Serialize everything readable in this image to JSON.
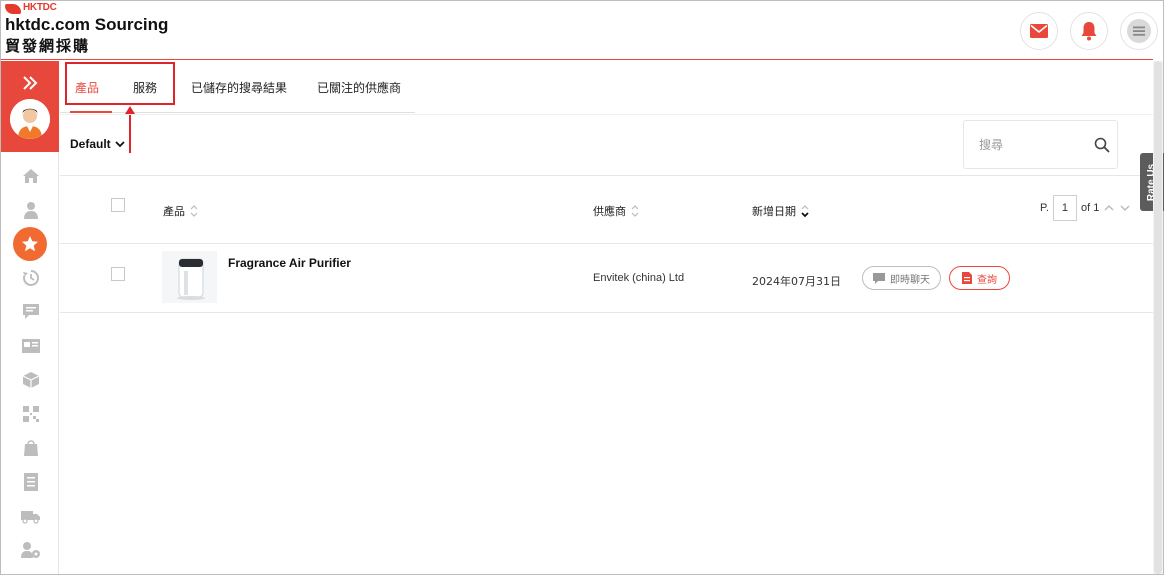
{
  "brand": {
    "logo_text": "HKTDC",
    "title": "hktdc.com Sourcing",
    "subtitle": "貿發網採購",
    "accent": "#e8483b"
  },
  "header": {
    "icons": [
      "mail-icon",
      "bell-icon",
      "hamburger-menu-icon"
    ]
  },
  "sidebar": {
    "items": [
      "home-icon",
      "user-icon",
      "star-icon",
      "history-icon",
      "message-icon",
      "card-icon",
      "box-icon",
      "qr-code-icon",
      "bag-icon",
      "document-icon",
      "truck-icon",
      "settings-icon"
    ],
    "active": "star-icon"
  },
  "tabs": [
    {
      "label": "產品"
    },
    {
      "label": "服務"
    },
    {
      "label": "已儲存的搜尋結果"
    },
    {
      "label": "已關注的供應商"
    }
  ],
  "toolbar": {
    "sort_label": "Default",
    "search_placeholder": "搜尋"
  },
  "table": {
    "headers": {
      "product": "產品",
      "supplier": "供應商",
      "date_added": "新增日期"
    },
    "pager": {
      "prefix": "P.",
      "current": "1",
      "of_label": "of 1"
    },
    "rows": [
      {
        "product_name": "Fragrance Air Purifier",
        "supplier": "Envitek (china) Ltd",
        "date_added": "2024年07月31日",
        "chat_label": "即時聊天",
        "inquire_label": "查詢"
      }
    ]
  },
  "rate_us": "Rate Us"
}
